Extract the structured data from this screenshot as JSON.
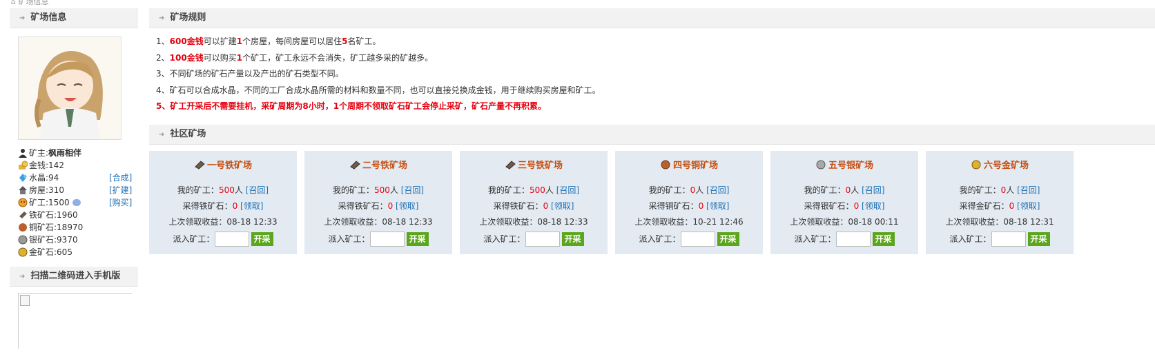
{
  "breadcrumb": "矿场信息",
  "sidebar": {
    "title": "矿场信息",
    "stats": [
      {
        "icon": "person-icon",
        "label": "矿主:",
        "value": "枫雨相伴",
        "action": ""
      },
      {
        "icon": "coins-icon",
        "label": "金钱:",
        "value": "142",
        "action": ""
      },
      {
        "icon": "crystal-icon",
        "label": "水晶:",
        "value": "94",
        "action": "[合成]"
      },
      {
        "icon": "house-icon",
        "label": "房屋:",
        "value": "310",
        "action": "[扩建]"
      },
      {
        "icon": "miner-icon",
        "label": "矿工:",
        "value": "1500",
        "action": "[购买]"
      },
      {
        "icon": "iron-ore-icon",
        "label": "铁矿石:",
        "value": "1960",
        "action": ""
      },
      {
        "icon": "copper-ore-icon",
        "label": "铜矿石:",
        "value": "18970",
        "action": ""
      },
      {
        "icon": "silver-ore-icon",
        "label": "银矿石:",
        "value": "9370",
        "action": ""
      },
      {
        "icon": "gold-ore-icon",
        "label": "金矿石:",
        "value": "605",
        "action": ""
      }
    ],
    "qr_title": "扫描二维码进入手机版"
  },
  "rules": {
    "title": "矿场规则",
    "items": [
      {
        "prefix": "1、",
        "hl1": "600金钱",
        "t1": "可以扩建",
        "hl2": "1",
        "t2": "个房屋，每间房屋可以居住",
        "hl3": "5",
        "t3": "名矿工。"
      },
      {
        "prefix": "2、",
        "hl1": "100金钱",
        "t1": "可以购买",
        "hl2": "1",
        "t2": "个矿工，矿工永远不会消失，矿工越多采的矿越多。",
        "hl3": "",
        "t3": ""
      },
      {
        "text": "3、不同矿场的矿石产量以及产出的矿石类型不同。"
      },
      {
        "text": "4、矿石可以合成水晶，不同的工厂合成水晶所需的材料和数量不同，也可以直接兑换成金钱，用于继续购买房屋和矿工。"
      },
      {
        "text": "5、矿工开采后不需要挂机，采矿周期为8小时，1个周期不领取矿石矿工会停止采矿，矿石产量不再积累。"
      }
    ]
  },
  "community": {
    "title": "社区矿场",
    "labels": {
      "my_miners": "我的矿工：",
      "unit": "人",
      "recall": "[召回]",
      "collect": "[领取]",
      "last_collect": "上次领取收益：",
      "dispatch": "派入矿工：",
      "start": "开采"
    },
    "mines": [
      {
        "name": "一号铁矿场",
        "icon": "iron-ore-icon",
        "miners": "500",
        "ore_label": "采得铁矿石：",
        "ore": "0",
        "last": "08-18 12:33"
      },
      {
        "name": "二号铁矿场",
        "icon": "iron-ore-icon",
        "miners": "500",
        "ore_label": "采得铁矿石：",
        "ore": "0",
        "last": "08-18 12:33"
      },
      {
        "name": "三号铁矿场",
        "icon": "iron-ore-icon",
        "miners": "500",
        "ore_label": "采得铁矿石：",
        "ore": "0",
        "last": "08-18 12:33"
      },
      {
        "name": "四号铜矿场",
        "icon": "copper-ore-icon",
        "miners": "0",
        "ore_label": "采得铜矿石：",
        "ore": "0",
        "last": "10-21 12:46"
      },
      {
        "name": "五号银矿场",
        "icon": "silver-ore-icon",
        "miners": "0",
        "ore_label": "采得银矿石：",
        "ore": "0",
        "last": "08-18 00:11"
      },
      {
        "name": "六号金矿场",
        "icon": "gold-ore-icon",
        "miners": "0",
        "ore_label": "采得金矿石：",
        "ore": "0",
        "last": "08-18 12:31"
      }
    ]
  }
}
